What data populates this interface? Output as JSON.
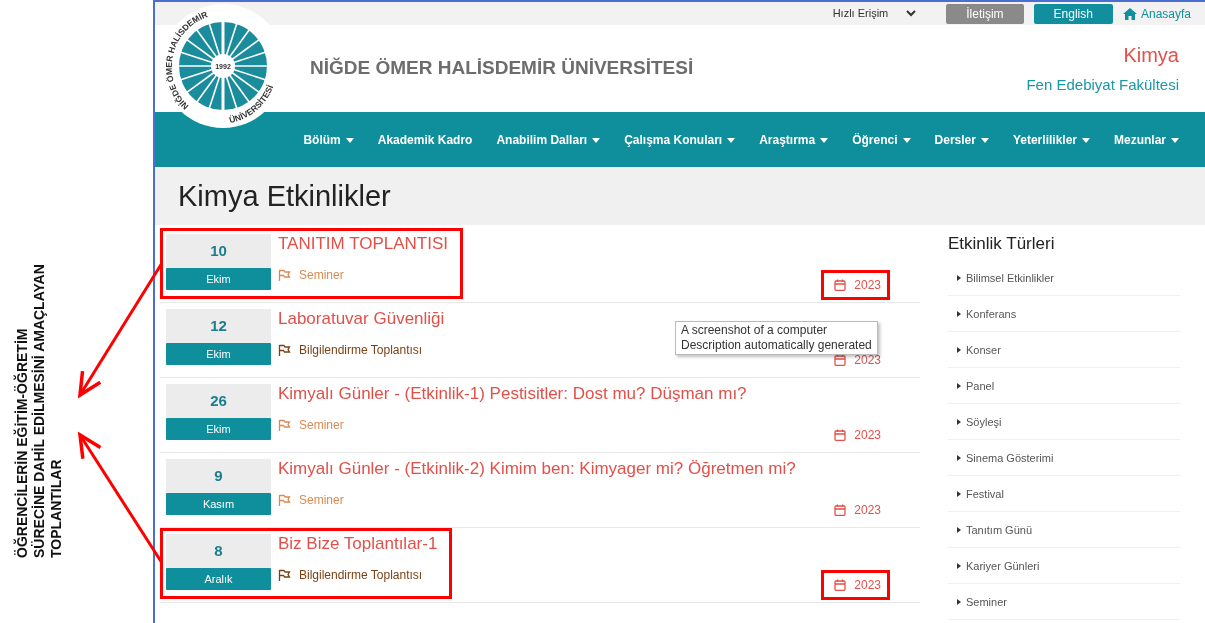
{
  "annotation": {
    "lines": [
      "ÖĞRENCİLERİN EĞİTİM-ÖĞRETİM",
      "SÜRECİNE DAHİL EDİLMESİNİ AMAÇLAYAN",
      "TOPLANTILAR"
    ]
  },
  "top_bar": {
    "quick_access": "Hızlı Erişim",
    "buttons": [
      {
        "label": "İletişim",
        "kind": "contact"
      },
      {
        "label": "English",
        "kind": "language"
      }
    ],
    "home_link": "Anasayfa"
  },
  "logo": {
    "arc_text": "NİĞDE ÖMER HALİSDEMİR",
    "arc_text_2": "ÜNİVERSİTESİ",
    "year": "1992"
  },
  "university_name": "NİĞDE ÖMER HALİSDEMİR ÜNİVERSİTESİ",
  "department": "Kimya",
  "faculty": "Fen Edebiyat Fakültesi",
  "nav": [
    {
      "label": "Bölüm",
      "has_menu": true
    },
    {
      "label": "Akademik Kadro",
      "has_menu": false
    },
    {
      "label": "Anabilim Dalları",
      "has_menu": true
    },
    {
      "label": "Çalışma Konuları",
      "has_menu": true
    },
    {
      "label": "Araştırma",
      "has_menu": true
    },
    {
      "label": "Öğrenci",
      "has_menu": true
    },
    {
      "label": "Dersler",
      "has_menu": true
    },
    {
      "label": "Yeterlilikler",
      "has_menu": true
    },
    {
      "label": "Mezunlar",
      "has_menu": true
    }
  ],
  "page_title": "Kimya Etkinlikler",
  "events": [
    {
      "day": "10",
      "month": "Ekim",
      "title": "TANITIM TOPLANTISI",
      "category": "Seminer",
      "color": "#d98a52",
      "year": "2023",
      "highlighted": true
    },
    {
      "day": "12",
      "month": "Ekim",
      "title": "Laboratuvar Güvenliği",
      "category": "Bilgilendirme Toplantısı",
      "color": "#7b3f12",
      "year": "2023",
      "highlighted": false
    },
    {
      "day": "26",
      "month": "Ekim",
      "title": "Kimyalı Günler - (Etkinlik-1) Pestisitler: Dost mu? Düşman mı?",
      "category": "Seminer",
      "color": "#d98a52",
      "year": "2023",
      "highlighted": false
    },
    {
      "day": "9",
      "month": "Kasım",
      "title": "Kimyalı Günler - (Etkinlik-2) Kimim ben: Kimyager mi? Öğretmen mi?",
      "category": "Seminer",
      "color": "#d98a52",
      "year": "2023",
      "highlighted": false
    },
    {
      "day": "8",
      "month": "Aralık",
      "title": "Biz Bize Toplantılar-1",
      "category": "Bilgilendirme Toplantısı",
      "color": "#7b3f12",
      "year": "2023",
      "highlighted": true
    }
  ],
  "sidebar": {
    "title": "Etkinlik Türleri",
    "items": [
      "Bilimsel Etkinlikler",
      "Konferans",
      "Konser",
      "Panel",
      "Söyleşi",
      "Sinema Gösterimi",
      "Festival",
      "Tanıtım Günü",
      "Kariyer Günleri",
      "Seminer"
    ]
  },
  "tooltip": {
    "lines": [
      "A screenshot of a computer",
      "Description automatically generated"
    ]
  }
}
